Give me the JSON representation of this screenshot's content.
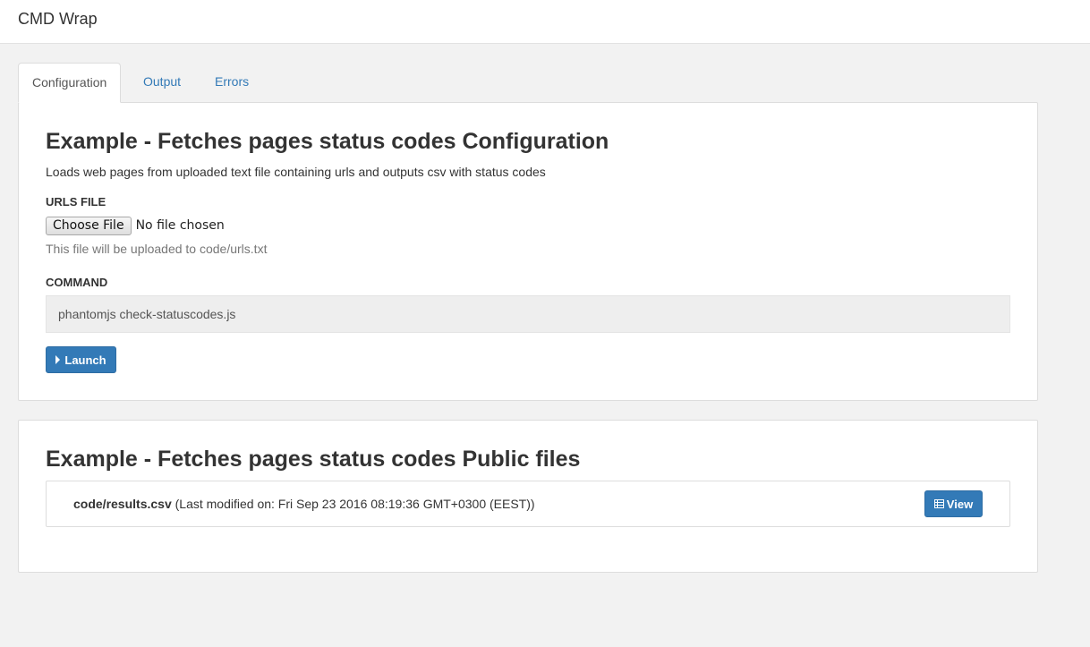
{
  "app": {
    "title": "CMD Wrap"
  },
  "tabs": [
    {
      "label": "Configuration",
      "active": true
    },
    {
      "label": "Output",
      "active": false
    },
    {
      "label": "Errors",
      "active": false
    }
  ],
  "config": {
    "heading": "Example - Fetches pages status codes Configuration",
    "description": "Loads web pages from uploaded text file containing urls and outputs csv with status codes",
    "urls_file": {
      "label": "URLS FILE",
      "choose_label": "Choose File",
      "status": "No file chosen",
      "help": "This file will be uploaded to code/urls.txt"
    },
    "command": {
      "label": "COMMAND",
      "value": "phantomjs check-statuscodes.js"
    },
    "launch_label": "Launch",
    "launch_icon": "caret-right-icon"
  },
  "public_files": {
    "heading": "Example - Fetches pages status codes Public files",
    "files": [
      {
        "name": "code/results.csv",
        "meta": "(Last modified on: Fri Sep 23 2016 08:19:36 GMT+0300 (EEST))",
        "view_label": "View",
        "view_icon": "list-icon"
      }
    ]
  },
  "colors": {
    "primary": "#337ab7",
    "link": "#337ab7",
    "background": "#f2f2f2"
  }
}
